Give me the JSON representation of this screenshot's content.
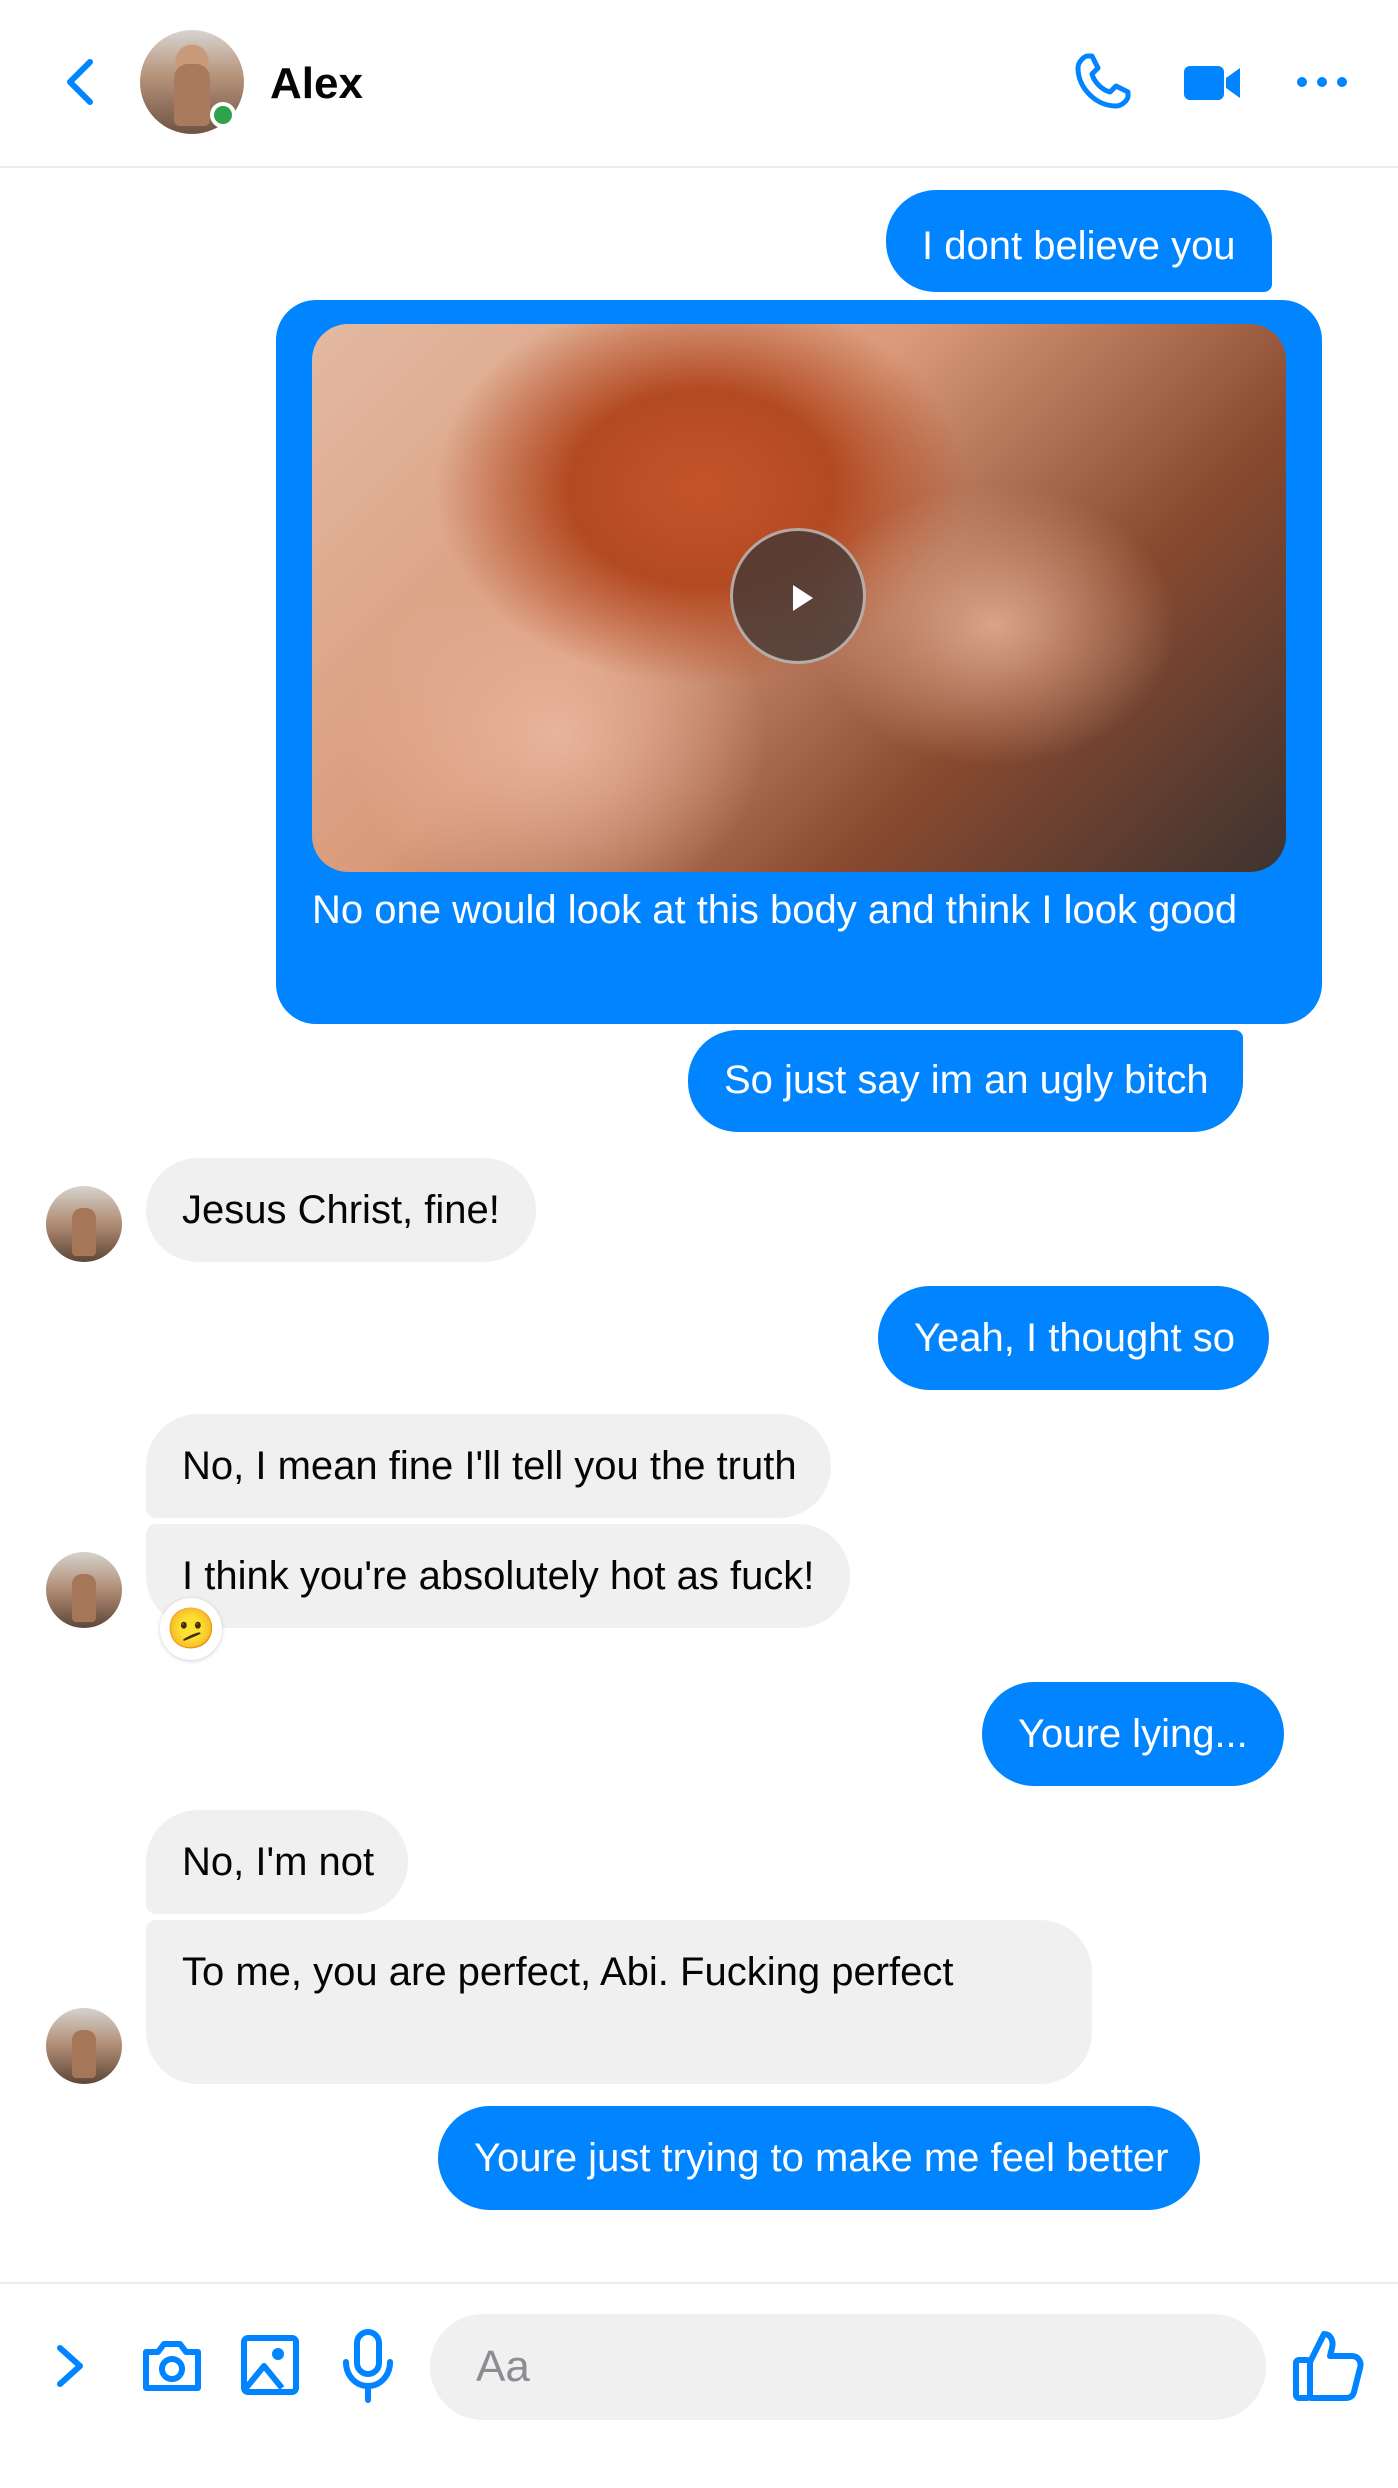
{
  "header": {
    "contact_name": "Alex",
    "online": true,
    "icons": [
      "back-arrow-icon",
      "phone-icon",
      "video-camera-icon",
      "more-options-icon"
    ]
  },
  "colors": {
    "accent": "#0084ff",
    "incoming_bubble": "#f0f0f0",
    "online": "#31a24c"
  },
  "messages": [
    {
      "from": "me",
      "text": "I dont believe you"
    },
    {
      "from": "me",
      "type": "video",
      "caption": "No one would look at this body and think I look good"
    },
    {
      "from": "me",
      "text": "So just say im an ugly bitch"
    },
    {
      "from": "Alex",
      "text": "Jesus Christ, fine!"
    },
    {
      "from": "me",
      "text": "Yeah, I thought so"
    },
    {
      "from": "Alex",
      "text": "No, I mean fine I'll tell you the truth"
    },
    {
      "from": "Alex",
      "text": "I think you're absolutely hot as fuck!",
      "reaction": "🫤"
    },
    {
      "from": "me",
      "text": "Youre lying..."
    },
    {
      "from": "Alex",
      "text": "No, I'm not"
    },
    {
      "from": "Alex",
      "text": "To me, you are perfect, Abi. Fucking perfect"
    },
    {
      "from": "me",
      "text": "Youre just trying to make me feel better"
    }
  ],
  "composer": {
    "placeholder": "Aa",
    "value": "",
    "icons": [
      "expand-chevron-icon",
      "camera-icon",
      "gallery-icon",
      "microphone-icon",
      "thumbs-up-icon"
    ]
  }
}
